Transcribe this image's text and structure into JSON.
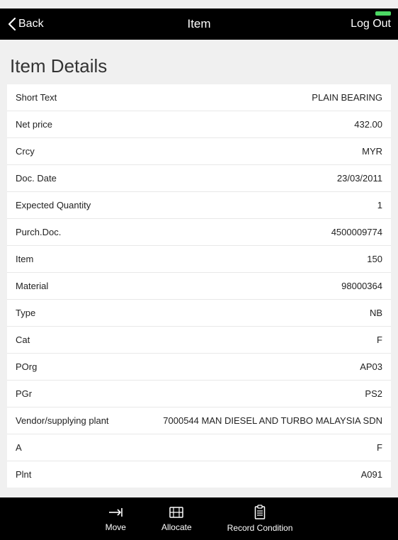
{
  "header": {
    "back_label": "Back",
    "title": "Item",
    "logout_label": "Log Out"
  },
  "page_title": "Item Details",
  "rows": [
    {
      "label": "Short Text",
      "value": "PLAIN BEARING"
    },
    {
      "label": "Net price",
      "value": "432.00"
    },
    {
      "label": "Crcy",
      "value": "MYR"
    },
    {
      "label": "Doc. Date",
      "value": "23/03/2011"
    },
    {
      "label": "Expected Quantity",
      "value": "1"
    },
    {
      "label": "Purch.Doc.",
      "value": "4500009774"
    },
    {
      "label": "Item",
      "value": "150"
    },
    {
      "label": "Material",
      "value": "98000364"
    },
    {
      "label": "Type",
      "value": "NB"
    },
    {
      "label": "Cat",
      "value": "F"
    },
    {
      "label": "POrg",
      "value": "AP03"
    },
    {
      "label": "PGr",
      "value": "PS2"
    },
    {
      "label": "Vendor/supplying plant",
      "value": "7000544   MAN DIESEL AND TURBO MALAYSIA SDN"
    },
    {
      "label": "A",
      "value": "F"
    },
    {
      "label": "Plnt",
      "value": "A091"
    }
  ],
  "toolbar": {
    "move_label": "Move",
    "allocate_label": "Allocate",
    "record_label": "Record Condition"
  }
}
